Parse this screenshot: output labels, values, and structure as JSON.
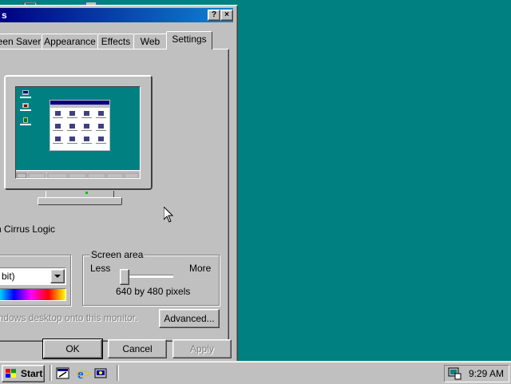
{
  "dialog": {
    "title": "s",
    "help_button": "?",
    "close_button": "×",
    "tabs": [
      {
        "label": "een Saver",
        "active": false
      },
      {
        "label": "Appearance",
        "active": false
      },
      {
        "label": "Effects",
        "active": false
      },
      {
        "label": "Web",
        "active": false
      },
      {
        "label": "Settings",
        "active": true
      }
    ],
    "display_device": "n Cirrus Logic",
    "colors_combo": {
      "value": "bit)",
      "arrow": "▼"
    },
    "screen_area": {
      "title": "Screen area",
      "less_label": "Less",
      "more_label": "More",
      "resolution": "640 by 480 pixels",
      "slider_level": 0
    },
    "extend_desktop_text": "indows desktop onto this monitor.",
    "advanced_button": "Advanced...",
    "ok_button": "OK",
    "cancel_button": "Cancel",
    "apply_button": "Apply"
  },
  "taskbar": {
    "start_label": "Start",
    "quick_launch": [
      "desktop-icon",
      "internet-explorer-icon",
      "channels-icon"
    ],
    "clock": "9:29 AM"
  },
  "colors": {
    "desktop": "#008080",
    "title_bar": "#000080",
    "face": "#c0c0c0"
  }
}
